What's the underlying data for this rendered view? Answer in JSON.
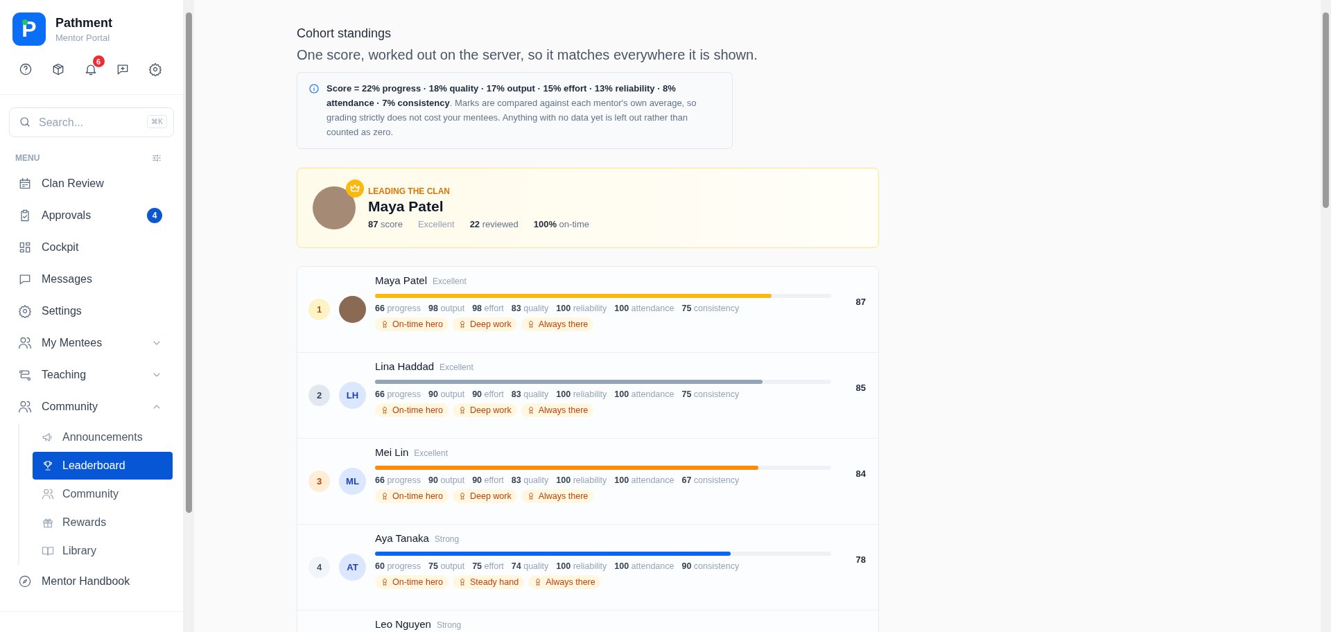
{
  "sidebar": {
    "logo_letter": "P",
    "brand": "Pathment",
    "subtitle": "Mentor Portal",
    "toolbar": [
      {
        "kind": "help"
      },
      {
        "kind": "box"
      },
      {
        "kind": "bell",
        "badge": "6"
      },
      {
        "kind": "message-plus"
      },
      {
        "kind": "gear"
      }
    ],
    "search": {
      "placeholder": "Search...",
      "shortcut": "⌘K"
    },
    "menu_label": "MENU",
    "items": [
      {
        "label": "Clan Review"
      },
      {
        "label": "Approvals",
        "badge": "4"
      },
      {
        "label": "Cockpit"
      },
      {
        "label": "Messages"
      },
      {
        "label": "Settings"
      },
      {
        "label": "My Mentees",
        "expanded": false
      },
      {
        "label": "Teaching",
        "expanded": false
      },
      {
        "label": "Community",
        "expanded": true,
        "children": [
          {
            "label": "Announcements",
            "selected": false
          },
          {
            "label": "Leaderboard",
            "selected": true
          },
          {
            "label": "Community",
            "selected": false
          },
          {
            "label": "Rewards",
            "selected": false
          },
          {
            "label": "Library",
            "selected": false
          }
        ]
      },
      {
        "label": "Mentor Handbook"
      }
    ]
  },
  "main": {
    "title": "Cohort standings",
    "subtitle": "One score, worked out on the server, so it matches everywhere it is shown.",
    "info": "**Score = 22% progress · 18% quality · 17% output · 15% effort · 13% reliability · 8% attendance · 7% consistency**. Marks are compared against each mentor's own average, so grading strictly does not cost your mentees. Anything with no data yet is left out rather than counted as zero.",
    "leader": {
      "heading": "LEADING THE CLAN",
      "name": "Maya Patel",
      "score": "**87** score",
      "tier": "Excellent",
      "reviewed": "**22** reviewed",
      "on_time": "**100%** on-time"
    },
    "rows": [
      {
        "rank": "1",
        "name": "Maya Patel",
        "tier": "Excellent",
        "level": 0.87,
        "color": "#fbb80f",
        "score": "87",
        "metrics": [
          "**66** progress",
          "**98** output",
          "**98** effort",
          "**83** quality",
          "**100** reliability",
          "**100** attendance",
          "**75** consistency"
        ],
        "badges": [
          "On-time hero",
          "Deep work",
          "Always there"
        ]
      },
      {
        "rank": "2",
        "initials": "LH",
        "name": "Lina Haddad",
        "tier": "Excellent",
        "level": 0.85,
        "color": "#94a3b8",
        "score": "85",
        "metrics": [
          "**66** progress",
          "**90** output",
          "**90** effort",
          "**83** quality",
          "**100** reliability",
          "**100** attendance",
          "**75** consistency"
        ],
        "badges": [
          "On-time hero",
          "Deep work",
          "Always there"
        ]
      },
      {
        "rank": "3",
        "initials": "ML",
        "name": "Mei Lin",
        "tier": "Excellent",
        "level": 0.84,
        "color": "#fb8c0a",
        "score": "84",
        "metrics": [
          "**66** progress",
          "**90** output",
          "**90** effort",
          "**83** quality",
          "**100** reliability",
          "**100** attendance",
          "**67** consistency"
        ],
        "badges": [
          "On-time hero",
          "Deep work",
          "Always there"
        ]
      },
      {
        "rank": "4",
        "initials": "AT",
        "name": "Aya Tanaka",
        "tier": "Strong",
        "level": 0.78,
        "color": "#0b66f0",
        "score": "78",
        "metrics": [
          "**60** progress",
          "**75** output",
          "**75** effort",
          "**74** quality",
          "**100** reliability",
          "**100** attendance",
          "**90** consistency"
        ],
        "badges": [
          "On-time hero",
          "Steady hand",
          "Always there"
        ]
      },
      {
        "name": "Leo Nguyen",
        "tier": "Strong"
      }
    ]
  }
}
